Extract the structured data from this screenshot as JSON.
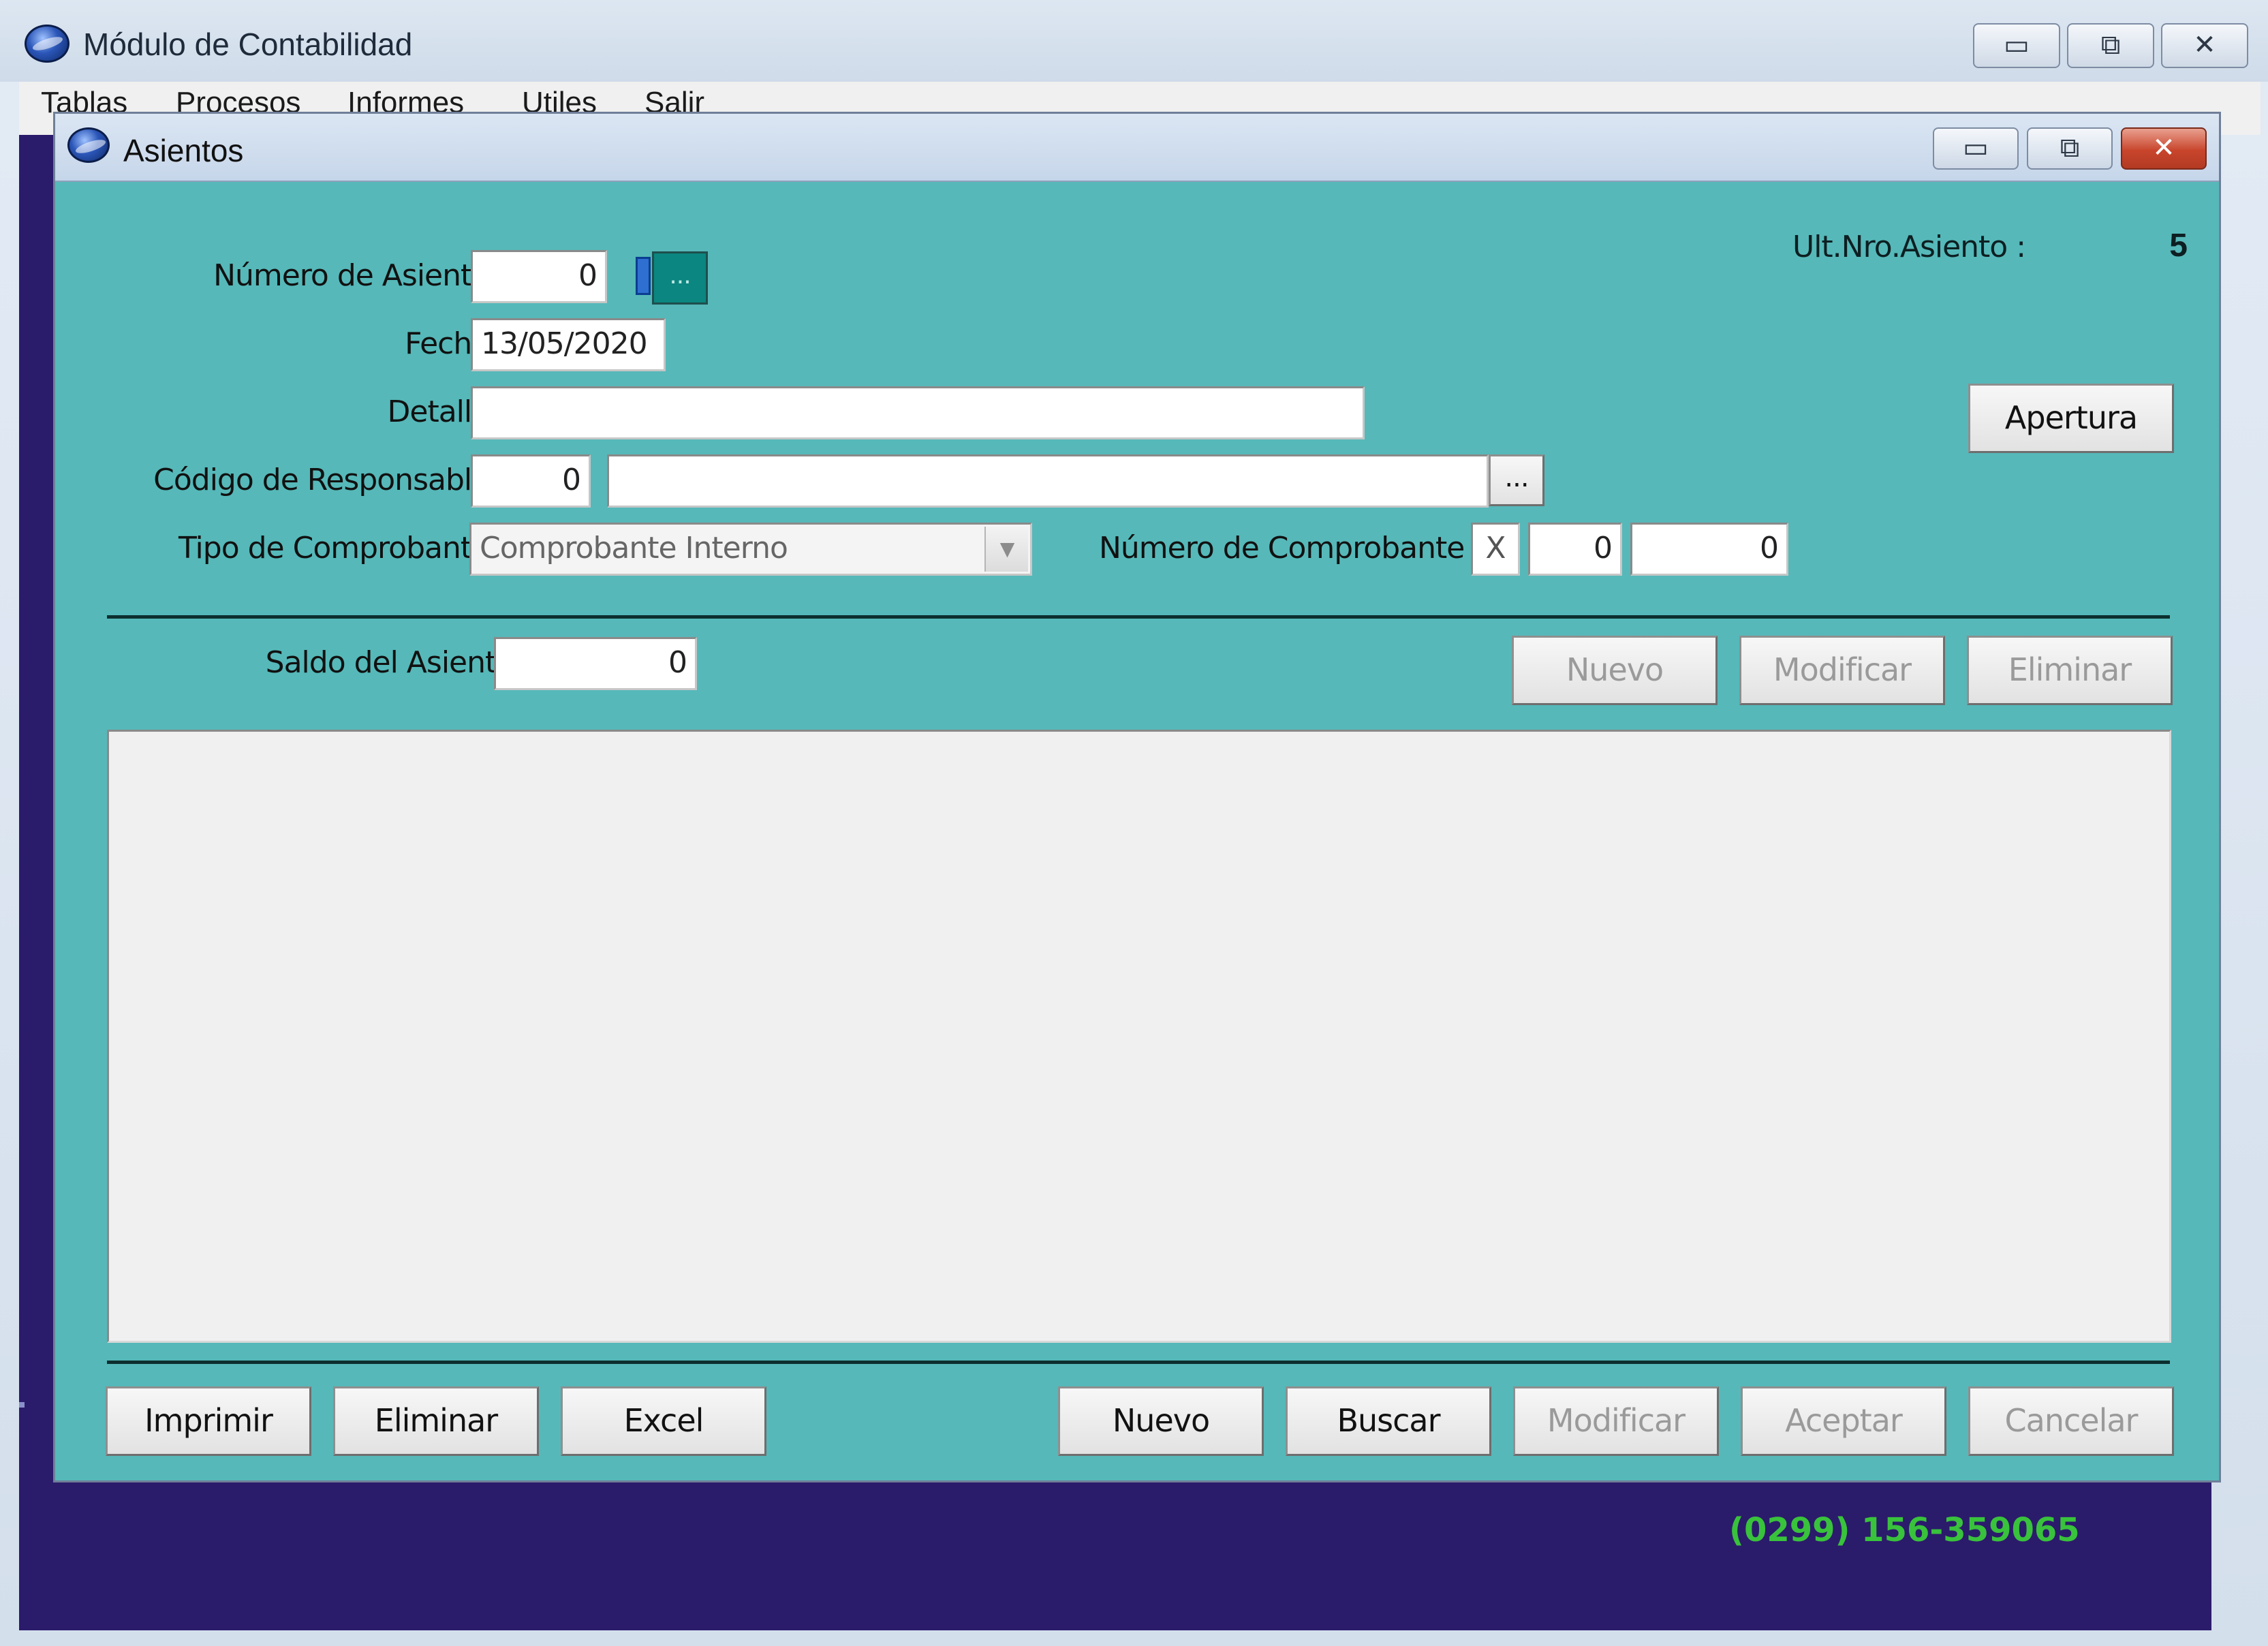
{
  "main_window": {
    "title": "Módulo de Contabilidad",
    "controls": {
      "minimize": "▭",
      "maximize": "⧉",
      "close": "✕"
    },
    "menu": [
      "Tablas",
      "Procesos",
      "Informes",
      "Utiles",
      "Salir"
    ],
    "phone": "(0299) 156-359065"
  },
  "child_window": {
    "title": "Asientos",
    "controls": {
      "minimize": "▭",
      "maximize": "⧉",
      "close": "✕"
    },
    "ult_nro_label": "Ult.Nro.Asiento :",
    "ult_nro_value": "5",
    "form": {
      "numero_asiento_label": "Número de Asiento :",
      "numero_asiento_value": "0",
      "numero_asiento_lookup": "...",
      "fecha_label": "Fecha :",
      "fecha_value": "13/05/2020",
      "detalle_label": "Detalle :",
      "detalle_value": "",
      "codigo_responsable_label": "Código de Responsable :",
      "codigo_responsable_value": "0",
      "responsable_name_value": "",
      "responsable_lookup": "...",
      "tipo_comprobante_label": "Tipo de Comprobante :",
      "tipo_comprobante_value": "Comprobante Interno",
      "numero_comprobante_label": "Número de Comprobante :",
      "numero_comprobante_letra": "X",
      "numero_comprobante_pv": "0",
      "numero_comprobante_nro": "0",
      "apertura_button": "Apertura",
      "saldo_label": "Saldo del Asiento :",
      "saldo_value": "0"
    },
    "line_buttons": {
      "nuevo": "Nuevo",
      "modificar": "Modificar",
      "eliminar": "Eliminar"
    },
    "footer_buttons": {
      "imprimir": "Imprimir",
      "eliminar": "Eliminar",
      "excel": "Excel",
      "nuevo": "Nuevo",
      "buscar": "Buscar",
      "modificar": "Modificar",
      "aceptar": "Aceptar",
      "cancelar": "Cancelar"
    },
    "colors": {
      "form_background": "#56b8b9",
      "desktop_background": "#2b1b6b",
      "phone_text": "#39c23c"
    }
  }
}
